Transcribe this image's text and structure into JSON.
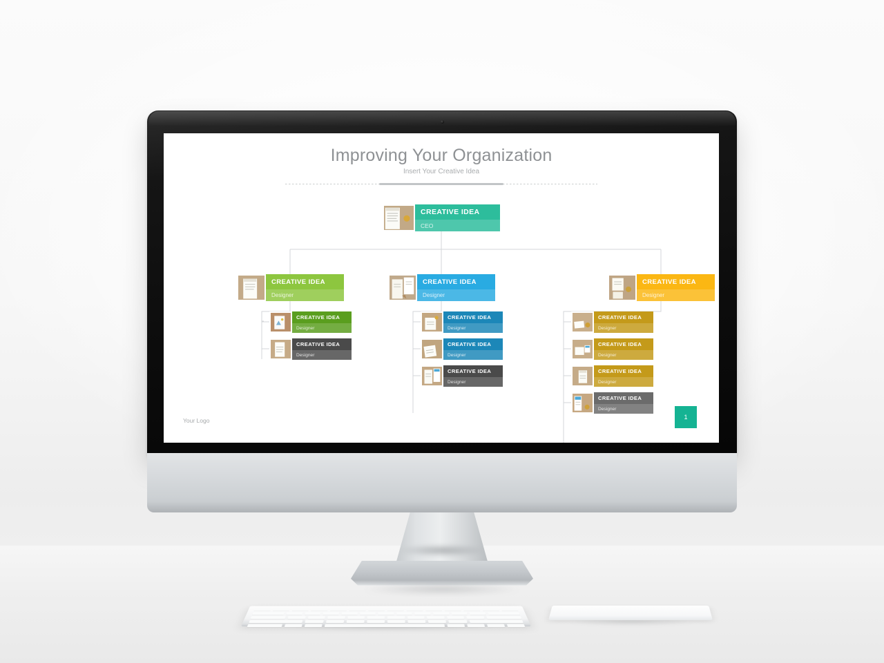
{
  "slide": {
    "title": "Improving Your Organization",
    "subtitle": "Insert Your Creative Idea",
    "logo": "Your Logo",
    "page_number": "1",
    "page_badge_color": "#15b393",
    "background": "#ffffff"
  },
  "org_chart": {
    "ceo": {
      "title": "CREATIVE IDEA",
      "role": "CEO",
      "color": "#2dbd9c",
      "thumb": "notepad-photo"
    },
    "branches": [
      {
        "id": "branch-green",
        "head": {
          "title": "CREATIVE IDEA",
          "role": "Designer",
          "color": "#8dc63f",
          "thumb": "sketchpad-photo"
        },
        "children": [
          {
            "title": "CREATIVE IDEA",
            "role": "Designer",
            "color": "#5a9e1e",
            "thumb": "drawing-photo"
          },
          {
            "title": "CREATIVE IDEA",
            "role": "Designer",
            "color": "#4a4a4a",
            "thumb": "notes-photo"
          }
        ]
      },
      {
        "id": "branch-blue",
        "head": {
          "title": "CREATIVE IDEA",
          "role": "Designer",
          "color": "#29abe2",
          "thumb": "tablet-photo"
        },
        "children": [
          {
            "title": "CREATIVE IDEA",
            "role": "Designer",
            "color": "#1c87b8",
            "thumb": "desk-photo"
          },
          {
            "title": "CREATIVE IDEA",
            "role": "Designer",
            "color": "#1c87b8",
            "thumb": "papers-photo"
          },
          {
            "title": "CREATIVE IDEA",
            "role": "Designer",
            "color": "#4a4a4a",
            "thumb": "report-photo"
          }
        ]
      },
      {
        "id": "branch-yellow",
        "head": {
          "title": "CREATIVE IDEA",
          "role": "Designer",
          "color": "#fbb713",
          "thumb": "board-photo"
        },
        "children": [
          {
            "title": "CREATIVE IDEA",
            "role": "Designer",
            "color": "#c49a1a",
            "thumb": "card-photo"
          },
          {
            "title": "CREATIVE IDEA",
            "role": "Designer",
            "color": "#c49a1a",
            "thumb": "notes2-photo"
          },
          {
            "title": "CREATIVE IDEA",
            "role": "Designer",
            "color": "#c49a1a",
            "thumb": "pad-photo"
          },
          {
            "title": "CREATIVE IDEA",
            "role": "Designer",
            "color": "#6b6b6b",
            "thumb": "phone-photo"
          }
        ]
      }
    ],
    "connector_color": "#d3d6d8"
  },
  "device": {
    "type": "desktop-monitor",
    "bezel_color": "#0d0d0d",
    "chin_color": "#d4d8db",
    "peripherals": [
      "keyboard",
      "trackpad"
    ]
  }
}
